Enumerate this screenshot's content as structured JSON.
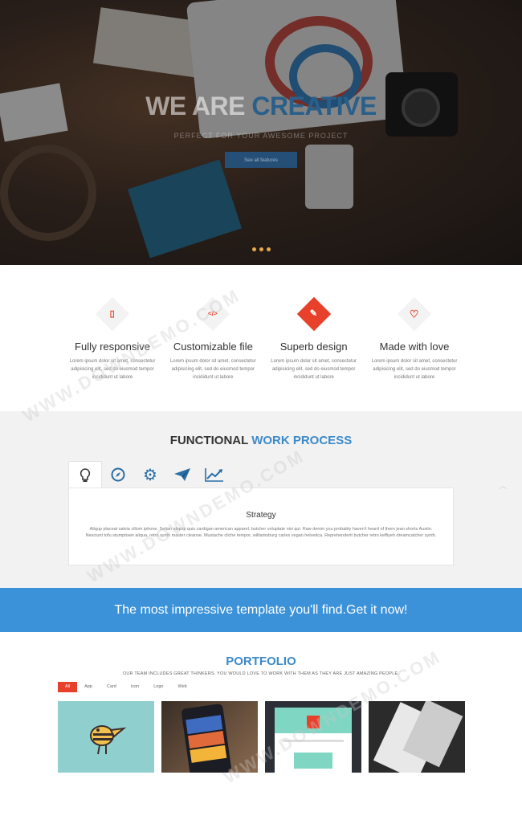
{
  "hero": {
    "title_part1": "WE ARE ",
    "title_part2": "CREATIVE",
    "subtitle": "PERFECT FOR YOUR AWESOME PROJECT",
    "button_label": "See all features",
    "accent_color": "#2a5f8a"
  },
  "features": [
    {
      "icon": "mobile-icon",
      "glyph": "▯",
      "title": "Fully responsive",
      "text": "Lorem ipsum dolor sit amet, consectetur adipisicing elit, sed do eiusmod tempor incididunt ut labore"
    },
    {
      "icon": "code-icon",
      "glyph": "</>",
      "title": "Customizable file",
      "text": "Lorem ipsum dolor sit amet, consectetur adipisicing elit, sed do eiusmod tempor incididunt ut labore"
    },
    {
      "icon": "paint-brush-icon",
      "glyph": "✎",
      "title": "Superb design",
      "text": "Lorem ipsum dolor sit amet, consectetur adipisicing elit, sed do eiusmod tempor incididunt ut labore"
    },
    {
      "icon": "heart-icon",
      "glyph": "♡",
      "title": "Made with love",
      "text": "Lorem ipsum dolor sit amet, consectetur adipisicing elit, sed do eiusmod tempor incididunt ut labore"
    }
  ],
  "process": {
    "title_part1": "FUNCTIONAL ",
    "title_part2": "WORK PROCESS",
    "tabs": [
      {
        "icon": "lightbulb-icon",
        "glyph": "💡"
      },
      {
        "icon": "compass-icon",
        "glyph": "◎"
      },
      {
        "icon": "gears-icon",
        "glyph": "⚙"
      },
      {
        "icon": "paper-plane-icon",
        "glyph": "➤"
      },
      {
        "icon": "line-chart-icon",
        "glyph": "📈"
      }
    ],
    "active_title": "Strategy",
    "active_text": "Aliqup placeat salvia cillum iphone. Seitan aliquip quis cardigan american apparel, butcher voluptate nisi qui. Raw denim you probably haven't heard of them jean shorts Austin. Nesciunt tofu stumptown aliqua, retro synth master cleanse. Mustache cliche tempor, williamsburg carles vegan helvetica. Reprehenderit butcher retro keffiyeh dreamcatcher synth."
  },
  "cta": {
    "text": "The most impressive template you'll find.Get it now!",
    "color": "#3b92d8"
  },
  "portfolio": {
    "title": "PORTFOLIO",
    "subtitle": "OUR TEAM INCLUDES GREAT THINKERS. YOU WOULD LOVE TO WORK WITH THEM AS THEY ARE JUST AMAZING PEOPLE.",
    "filters": [
      "All",
      "App",
      "Card",
      "Icon",
      "Logo",
      "Web"
    ],
    "active_filter": "All"
  },
  "watermark": "WWW.DOWNDEMO.COM"
}
